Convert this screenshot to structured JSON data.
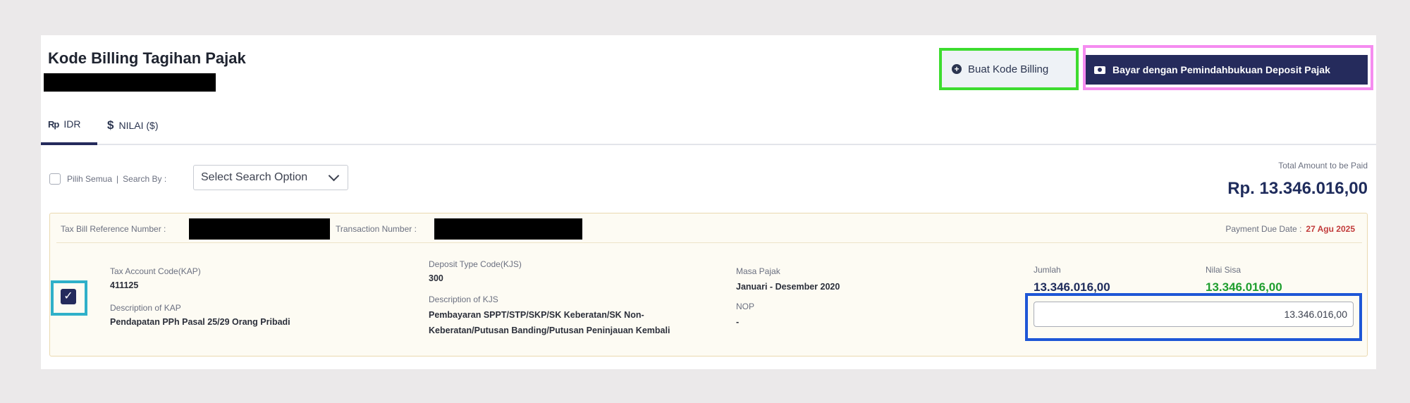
{
  "page": {
    "title": "Kode Billing Tagihan Pajak"
  },
  "actions": {
    "buat_label": "Buat Kode Billing",
    "bayar_label": "Bayar dengan Pemindahbukuan Deposit Pajak"
  },
  "tabs": [
    {
      "icon": "Rp",
      "label": "IDR",
      "active": true
    },
    {
      "icon": "$",
      "label": "NILAI ($)",
      "active": false
    }
  ],
  "filter": {
    "select_all": "Pilih Semua",
    "separator": "|",
    "search_by": "Search By :",
    "search_option": "Select Search Option"
  },
  "total": {
    "label": "Total Amount to be Paid",
    "value": "Rp. 13.346.016,00"
  },
  "bill": {
    "ref_label": "Tax Bill Reference Number :",
    "trx_label": "Transaction Number :",
    "due_label": "Payment Due Date :",
    "due_value": "27 Agu 2025",
    "kap_label": "Tax Account Code(KAP)",
    "kap_value": "411125",
    "desc_kap_label": "Description of KAP",
    "desc_kap_value": "Pendapatan PPh Pasal 25/29 Orang Pribadi",
    "kjs_label": "Deposit Type Code(KJS)",
    "kjs_value": "300",
    "desc_kjs_label": "Description of KJS",
    "desc_kjs_line1": "Pembayaran SPPT/STP/SKP/SK Keberatan/SK Non-",
    "desc_kjs_line2": "Keberatan/Putusan Banding/Putusan Peninjauan Kembali",
    "masa_label": "Masa Pajak",
    "masa_value": "Januari - Desember 2020",
    "nop_label": "NOP",
    "nop_value": "-",
    "jumlah_label": "Jumlah",
    "jumlah_value": "13.346.016,00",
    "sisa_label": "Nilai Sisa",
    "sisa_value": "13.346.016,00",
    "amount_input_value": "13.346.016,00"
  },
  "colors": {
    "primary": "#252b5c",
    "due_date": "#c23b3b",
    "sisa": "#1e9e2e",
    "frame_green": "#3ddc2f",
    "frame_pink": "#f58cf0",
    "frame_cyan": "#2fb0c9",
    "frame_blue": "#1e56d6"
  }
}
